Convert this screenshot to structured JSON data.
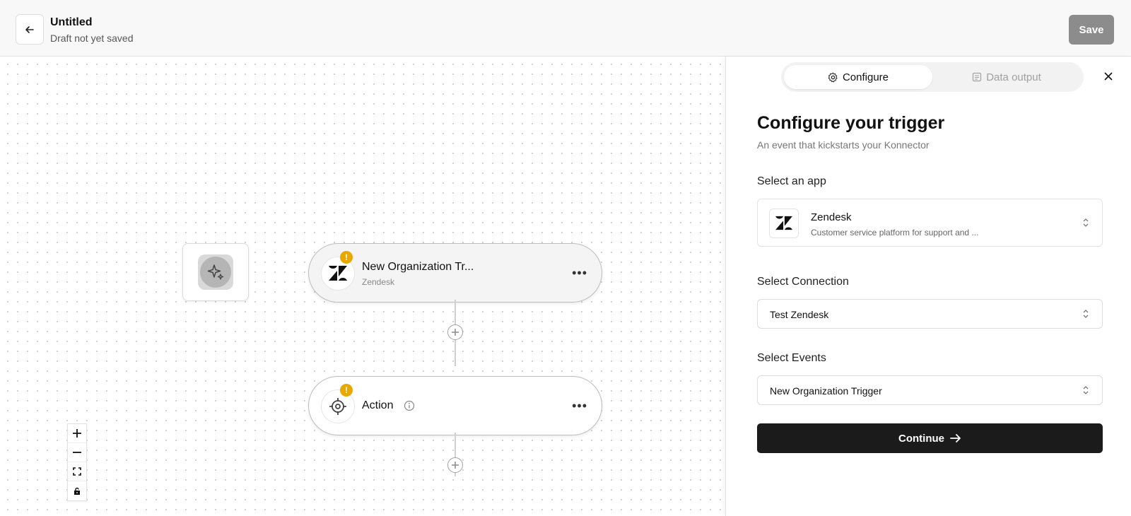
{
  "header": {
    "title": "Untitled",
    "subtitle": "Draft not yet saved",
    "save_label": "Save"
  },
  "canvas": {
    "trigger_node": {
      "title": "New Organization Tr...",
      "app": "Zendesk",
      "warning": "!"
    },
    "action_node": {
      "title": "Action",
      "warning": "!"
    },
    "icons": {
      "ai": "sparkles-icon",
      "trigger": "zendesk-logo-icon",
      "action": "target-icon",
      "plus": "plus-circle-icon"
    },
    "zoom_controls": [
      "zoom-in",
      "zoom-out",
      "fit-view",
      "lock"
    ]
  },
  "panel": {
    "tabs": [
      {
        "label": "Configure",
        "icon": "gear-icon",
        "active": true
      },
      {
        "label": "Data output",
        "icon": "document-icon",
        "active": false
      }
    ],
    "heading": "Configure your trigger",
    "subheading": "An event that kickstarts your Konnector",
    "app_label": "Select an app",
    "app": {
      "name": "Zendesk",
      "description": "Customer service platform for support and ..."
    },
    "connection_label": "Select Connection",
    "connection_value": "Test Zendesk",
    "events_label": "Select Events",
    "events_value": "New Organization Trigger",
    "continue_label": "Continue"
  },
  "colors": {
    "warning": "#e8a800",
    "primary_button": "#1b1b1b",
    "save_button": "#8c8c8c"
  }
}
